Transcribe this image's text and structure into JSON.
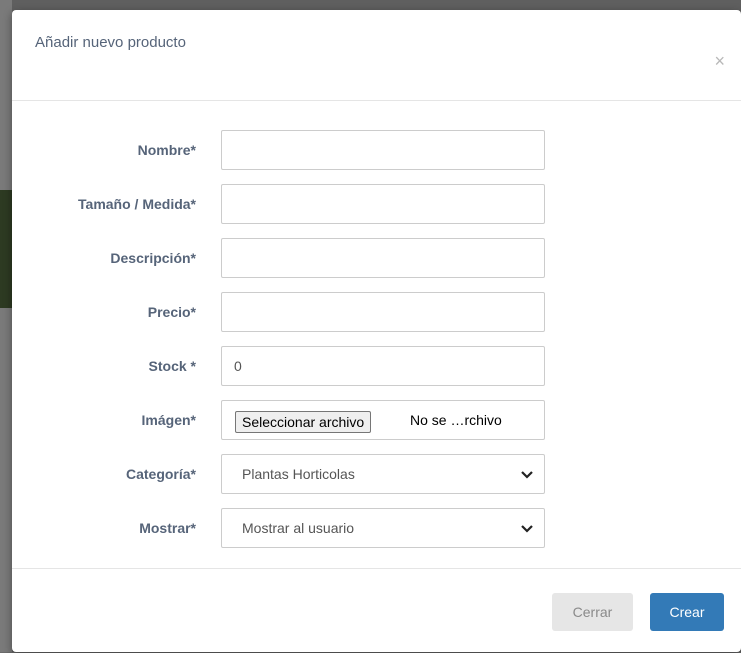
{
  "modal": {
    "title": "Añadir nuevo producto",
    "close_glyph": "×"
  },
  "form": {
    "fields": [
      {
        "label": "Nombre*",
        "value": ""
      },
      {
        "label": "Tamaño / Medida*",
        "value": ""
      },
      {
        "label": "Descripción*",
        "value": ""
      },
      {
        "label": "Precio*",
        "value": ""
      },
      {
        "label": "Stock *",
        "value": "0"
      }
    ],
    "image": {
      "label": "Imágen*",
      "button_label": "Seleccionar archivo",
      "status_text": "No se …rchivo"
    },
    "category": {
      "label": "Categoría*",
      "selected": "Plantas Horticolas"
    },
    "show": {
      "label": "Mostrar*",
      "selected": "Mostrar al usuario"
    }
  },
  "footer": {
    "close_label": "Cerrar",
    "create_label": "Crear"
  },
  "colors": {
    "primary": "#337ab7",
    "label": "#566479"
  },
  "icons": {
    "close": "close-icon",
    "chevron": "chevron-down-icon"
  }
}
